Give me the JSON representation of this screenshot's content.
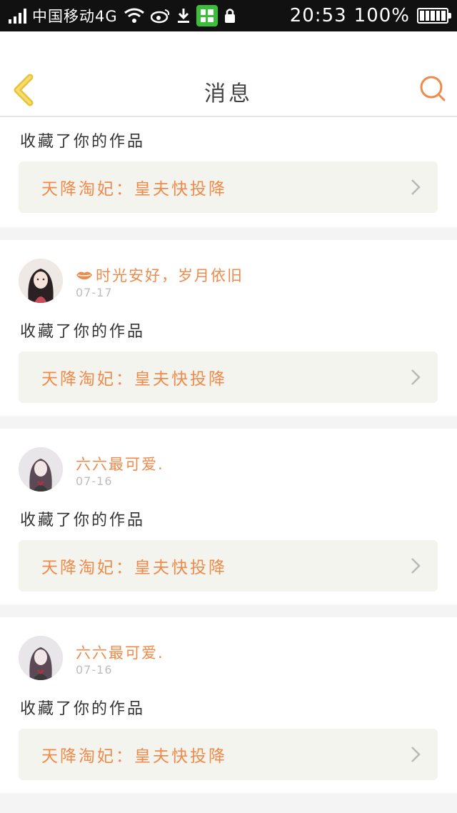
{
  "statusbar": {
    "carrier": "中国移动4G",
    "time": "20:53",
    "battery": "100%"
  },
  "header": {
    "title": "消息"
  },
  "colors": {
    "accent": "#f08a4b",
    "back_icon": "#f2c94c",
    "work_bg": "#f4f4ef"
  },
  "messages": [
    {
      "action": "收藏了你的作品",
      "work_title": "天降淘妃：皇夫快投降"
    },
    {
      "username": "时光安好，岁月依旧",
      "date": "07-17",
      "action": "收藏了你的作品",
      "work_title": "天降淘妃：皇夫快投降",
      "badge_icon": "lips-icon"
    },
    {
      "username": "六六最可爱.",
      "date": "07-16",
      "action": "收藏了你的作品",
      "work_title": "天降淘妃：皇夫快投降"
    },
    {
      "username": "六六最可爱.",
      "date": "07-16",
      "action": "收藏了你的作品",
      "work_title": "天降淘妃：皇夫快投降"
    }
  ]
}
